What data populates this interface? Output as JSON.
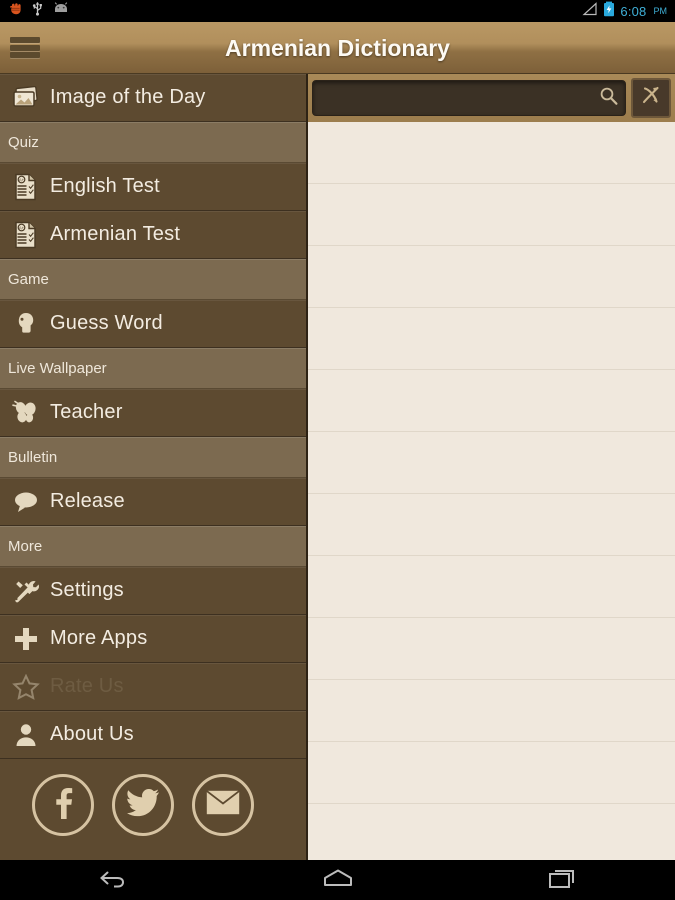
{
  "status_bar": {
    "left_icons": [
      "fist-icon",
      "usb-icon",
      "android-head-icon"
    ],
    "signal_icon": "signal-triangle-icon",
    "battery_icon": "battery-charging-icon",
    "time": "6:08",
    "ampm": "PM",
    "accent_color": "#3fb0d8"
  },
  "action_bar": {
    "menu_icon": "hamburger-menu-icon",
    "title": "Armenian Dictionary"
  },
  "search": {
    "value": "",
    "placeholder": "",
    "search_icon": "magnifier-icon",
    "swap_icon": "language-swap-icon"
  },
  "drawer": {
    "items": [
      {
        "label": "Image of the Day",
        "icon": "gallery-icon",
        "type": "item",
        "name": "image-of-the-day",
        "enabled": true
      },
      {
        "label": "Quiz",
        "type": "section",
        "name": "quiz"
      },
      {
        "label": "English Test",
        "icon": "test-paper-icon",
        "type": "item",
        "name": "english-test",
        "enabled": true
      },
      {
        "label": "Armenian Test",
        "icon": "test-paper-icon",
        "type": "item",
        "name": "armenian-test",
        "enabled": true
      },
      {
        "label": "Game",
        "type": "section",
        "name": "game"
      },
      {
        "label": "Guess Word",
        "icon": "head-profile-icon",
        "type": "item",
        "name": "guess-word",
        "enabled": true
      },
      {
        "label": "Live Wallpaper",
        "type": "section",
        "name": "live-wallpaper"
      },
      {
        "label": "Teacher",
        "icon": "butterfly-icon",
        "type": "item",
        "name": "teacher",
        "enabled": true
      },
      {
        "label": "Bulletin",
        "type": "section",
        "name": "bulletin"
      },
      {
        "label": "Release",
        "icon": "speech-bubble-icon",
        "type": "item",
        "name": "release",
        "enabled": true
      },
      {
        "label": "More",
        "type": "section",
        "name": "more"
      },
      {
        "label": "Settings",
        "icon": "tools-icon",
        "type": "item",
        "name": "settings",
        "enabled": true
      },
      {
        "label": "More Apps",
        "icon": "plus-icon",
        "type": "item",
        "name": "more-apps",
        "enabled": true
      },
      {
        "label": "Rate Us",
        "icon": "star-outline-icon",
        "type": "item",
        "name": "rate-us",
        "enabled": false
      },
      {
        "label": "About Us",
        "icon": "person-icon",
        "type": "item",
        "name": "about-us",
        "enabled": true
      }
    ],
    "social": [
      {
        "name": "facebook-button",
        "icon": "facebook-icon"
      },
      {
        "name": "twitter-button",
        "icon": "twitter-icon"
      },
      {
        "name": "email-button",
        "icon": "envelope-icon"
      }
    ],
    "colors": {
      "item_bg": "#5d4a30",
      "section_bg": "#7c6a50",
      "text": "#f3ece1",
      "disabled_text": "#6e5c42"
    }
  },
  "main": {
    "background_color": "#f0e8dd",
    "empty_rows": 12
  },
  "nav_bar": {
    "buttons": [
      {
        "name": "back-button",
        "icon": "back-arrow-icon"
      },
      {
        "name": "home-button",
        "icon": "home-icon"
      },
      {
        "name": "recents-button",
        "icon": "recent-apps-icon"
      }
    ]
  }
}
